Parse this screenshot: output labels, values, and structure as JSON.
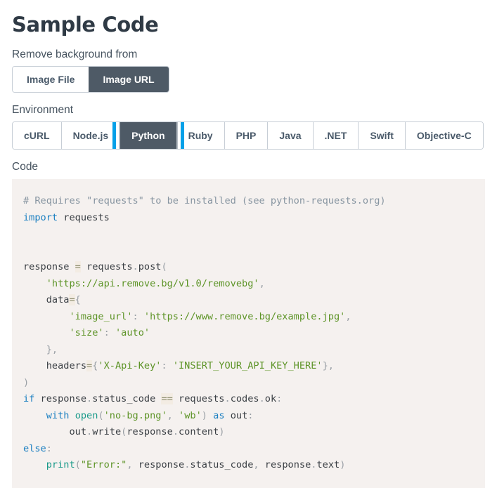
{
  "header": {
    "title": "Sample Code"
  },
  "source": {
    "label": "Remove background from",
    "options": [
      "Image File",
      "Image URL"
    ],
    "selected": "Image URL"
  },
  "environment": {
    "label": "Environment",
    "tabs": [
      "cURL",
      "Node.js",
      "Python",
      "Ruby",
      "PHP",
      "Java",
      ".NET",
      "Swift",
      "Objective-C"
    ],
    "selected": "Python",
    "focused": "Python"
  },
  "code": {
    "label": "Code",
    "language": "Python",
    "lines": [
      [
        {
          "t": "# Requires \"requests\" to be installed (see python-requests.org)",
          "c": "tok-comment"
        }
      ],
      [
        {
          "t": "import",
          "c": "tok-keyword"
        },
        {
          "t": " requests",
          "c": "tok-plain"
        }
      ],
      [],
      [],
      [
        {
          "t": "response ",
          "c": "tok-plain"
        },
        {
          "t": "=",
          "c": "tok-op"
        },
        {
          "t": " requests",
          "c": "tok-plain"
        },
        {
          "t": ".",
          "c": "tok-punc"
        },
        {
          "t": "post",
          "c": "tok-plain"
        },
        {
          "t": "(",
          "c": "tok-punc"
        }
      ],
      [
        {
          "t": "    ",
          "c": "tok-plain"
        },
        {
          "t": "'https://api.remove.bg/v1.0/removebg'",
          "c": "tok-string"
        },
        {
          "t": ",",
          "c": "tok-punc"
        }
      ],
      [
        {
          "t": "    data",
          "c": "tok-plain"
        },
        {
          "t": "=",
          "c": "tok-op"
        },
        {
          "t": "{",
          "c": "tok-punc"
        }
      ],
      [
        {
          "t": "        ",
          "c": "tok-plain"
        },
        {
          "t": "'image_url'",
          "c": "tok-string"
        },
        {
          "t": ": ",
          "c": "tok-punc"
        },
        {
          "t": "'https://www.remove.bg/example.jpg'",
          "c": "tok-string"
        },
        {
          "t": ",",
          "c": "tok-punc"
        }
      ],
      [
        {
          "t": "        ",
          "c": "tok-plain"
        },
        {
          "t": "'size'",
          "c": "tok-string"
        },
        {
          "t": ": ",
          "c": "tok-punc"
        },
        {
          "t": "'auto'",
          "c": "tok-string"
        }
      ],
      [
        {
          "t": "    ",
          "c": "tok-plain"
        },
        {
          "t": "},",
          "c": "tok-punc"
        }
      ],
      [
        {
          "t": "    headers",
          "c": "tok-plain"
        },
        {
          "t": "=",
          "c": "tok-op"
        },
        {
          "t": "{",
          "c": "tok-punc"
        },
        {
          "t": "'X-Api-Key'",
          "c": "tok-string"
        },
        {
          "t": ": ",
          "c": "tok-punc"
        },
        {
          "t": "'INSERT_YOUR_API_KEY_HERE'",
          "c": "tok-string"
        },
        {
          "t": "},",
          "c": "tok-punc"
        }
      ],
      [
        {
          "t": ")",
          "c": "tok-punc"
        }
      ],
      [
        {
          "t": "if",
          "c": "tok-keyword"
        },
        {
          "t": " response",
          "c": "tok-plain"
        },
        {
          "t": ".",
          "c": "tok-punc"
        },
        {
          "t": "status_code ",
          "c": "tok-plain"
        },
        {
          "t": "==",
          "c": "tok-op"
        },
        {
          "t": " requests",
          "c": "tok-plain"
        },
        {
          "t": ".",
          "c": "tok-punc"
        },
        {
          "t": "codes",
          "c": "tok-plain"
        },
        {
          "t": ".",
          "c": "tok-punc"
        },
        {
          "t": "ok",
          "c": "tok-plain"
        },
        {
          "t": ":",
          "c": "tok-punc"
        }
      ],
      [
        {
          "t": "    ",
          "c": "tok-plain"
        },
        {
          "t": "with",
          "c": "tok-keyword"
        },
        {
          "t": " ",
          "c": "tok-plain"
        },
        {
          "t": "open",
          "c": "tok-builtin"
        },
        {
          "t": "(",
          "c": "tok-punc"
        },
        {
          "t": "'no-bg.png'",
          "c": "tok-string"
        },
        {
          "t": ", ",
          "c": "tok-punc"
        },
        {
          "t": "'wb'",
          "c": "tok-string"
        },
        {
          "t": ")",
          "c": "tok-punc"
        },
        {
          "t": " ",
          "c": "tok-plain"
        },
        {
          "t": "as",
          "c": "tok-keyword"
        },
        {
          "t": " out",
          "c": "tok-plain"
        },
        {
          "t": ":",
          "c": "tok-punc"
        }
      ],
      [
        {
          "t": "        out",
          "c": "tok-plain"
        },
        {
          "t": ".",
          "c": "tok-punc"
        },
        {
          "t": "write",
          "c": "tok-plain"
        },
        {
          "t": "(",
          "c": "tok-punc"
        },
        {
          "t": "response",
          "c": "tok-plain"
        },
        {
          "t": ".",
          "c": "tok-punc"
        },
        {
          "t": "content",
          "c": "tok-plain"
        },
        {
          "t": ")",
          "c": "tok-punc"
        }
      ],
      [
        {
          "t": "else",
          "c": "tok-keyword"
        },
        {
          "t": ":",
          "c": "tok-punc"
        }
      ],
      [
        {
          "t": "    ",
          "c": "tok-plain"
        },
        {
          "t": "print",
          "c": "tok-builtin"
        },
        {
          "t": "(",
          "c": "tok-punc"
        },
        {
          "t": "\"Error:\"",
          "c": "tok-string"
        },
        {
          "t": ", ",
          "c": "tok-punc"
        },
        {
          "t": "response",
          "c": "tok-plain"
        },
        {
          "t": ".",
          "c": "tok-punc"
        },
        {
          "t": "status_code",
          "c": "tok-plain"
        },
        {
          "t": ", ",
          "c": "tok-punc"
        },
        {
          "t": "response",
          "c": "tok-plain"
        },
        {
          "t": ".",
          "c": "tok-punc"
        },
        {
          "t": "text",
          "c": "tok-plain"
        },
        {
          "t": ")",
          "c": "tok-punc"
        }
      ]
    ]
  },
  "colors": {
    "accent_focus_ring": "#05a0e8",
    "active_tab_bg": "#4e5a66",
    "code_bg": "#f5f1ef",
    "string": "#5d9427",
    "keyword": "#1a7fc1",
    "builtin": "#1a9a8a",
    "comment": "#8795a1"
  }
}
